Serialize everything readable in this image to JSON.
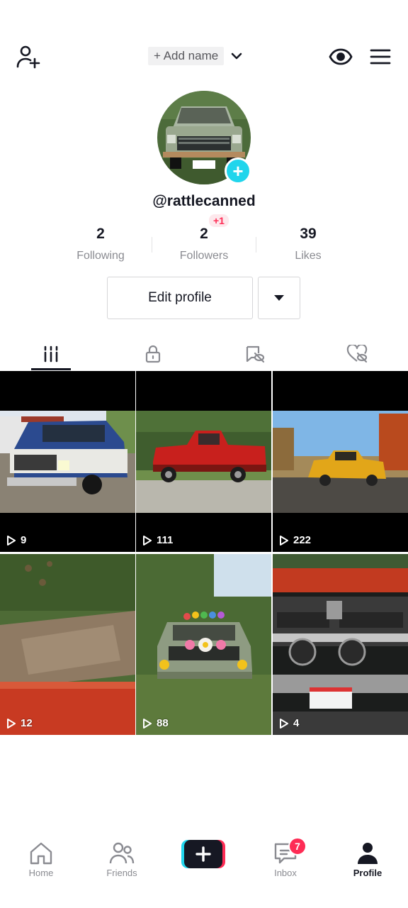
{
  "header": {
    "add_name_label": "+ Add name"
  },
  "profile": {
    "username": "@rattlecanned",
    "stats": [
      {
        "value": "2",
        "label": "Following"
      },
      {
        "value": "2",
        "label": "Followers",
        "badge": "+1"
      },
      {
        "value": "39",
        "label": "Likes"
      }
    ],
    "edit_profile_label": "Edit profile"
  },
  "tabs": [
    {
      "icon": "grid-icon",
      "active": true
    },
    {
      "icon": "lock-icon",
      "active": false
    },
    {
      "icon": "repost-icon",
      "active": false
    },
    {
      "icon": "heart-hidden-icon",
      "active": false
    }
  ],
  "videos": [
    {
      "views": "9",
      "subject": "blue-white-truck"
    },
    {
      "views": "111",
      "subject": "red-truck"
    },
    {
      "views": "222",
      "subject": "yellow-truck"
    },
    {
      "views": "12",
      "subject": "muddy-trail"
    },
    {
      "views": "88",
      "subject": "truck-with-stickers"
    },
    {
      "views": "4",
      "subject": "dodge-front"
    }
  ],
  "bottom_nav": {
    "items": [
      {
        "label": "Home",
        "icon": "home-icon"
      },
      {
        "label": "Friends",
        "icon": "friends-icon"
      },
      {
        "label": "",
        "icon": "create-plus-icon"
      },
      {
        "label": "Inbox",
        "icon": "inbox-icon",
        "badge": "7"
      },
      {
        "label": "Profile",
        "icon": "profile-icon",
        "active": true
      }
    ]
  },
  "colors": {
    "accent": "#fe2c55",
    "cyan": "#20d5ec",
    "text": "#161823",
    "muted": "#8a8b91"
  }
}
